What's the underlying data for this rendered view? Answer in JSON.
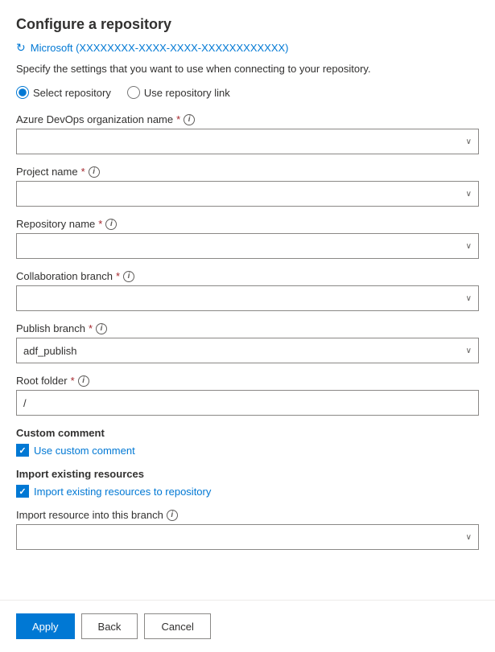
{
  "page": {
    "title": "Configure a repository",
    "org_icon": "↻",
    "org_name": "Microsoft (XXXXXXXX-XXXX-XXXX-XXXXXXXXXXXX)",
    "description": "Specify the settings that you want to use when connecting to your repository.",
    "radio_options": [
      {
        "id": "select-repo",
        "label": "Select repository",
        "checked": true
      },
      {
        "id": "use-link",
        "label": "Use repository link",
        "checked": false
      }
    ],
    "fields": [
      {
        "id": "azure-devops-org",
        "label": "Azure DevOps organization name",
        "required": true,
        "has_info": true,
        "type": "dropdown",
        "value": "",
        "placeholder": ""
      },
      {
        "id": "project-name",
        "label": "Project name",
        "required": true,
        "has_info": true,
        "type": "dropdown",
        "value": "",
        "placeholder": ""
      },
      {
        "id": "repository-name",
        "label": "Repository name",
        "required": true,
        "has_info": true,
        "type": "dropdown",
        "value": "",
        "placeholder": ""
      },
      {
        "id": "collaboration-branch",
        "label": "Collaboration branch",
        "required": true,
        "has_info": true,
        "type": "dropdown",
        "value": "",
        "placeholder": ""
      },
      {
        "id": "publish-branch",
        "label": "Publish branch",
        "required": true,
        "has_info": true,
        "type": "dropdown",
        "value": "adf_publish",
        "placeholder": ""
      },
      {
        "id": "root-folder",
        "label": "Root folder",
        "required": true,
        "has_info": true,
        "type": "text",
        "value": "/",
        "placeholder": ""
      }
    ],
    "checkboxes": [
      {
        "id": "custom-comment",
        "section_label": "Custom comment",
        "label": "Use custom comment",
        "checked": true
      },
      {
        "id": "import-resources",
        "section_label": "Import existing resources",
        "label": "Import existing resources to repository",
        "checked": true
      }
    ],
    "import_branch_field": {
      "id": "import-branch",
      "label": "Import resource into this branch",
      "has_info": true,
      "type": "dropdown",
      "value": "",
      "placeholder": ""
    },
    "buttons": {
      "apply": "Apply",
      "back": "Back",
      "cancel": "Cancel"
    },
    "info_icon_label": "i",
    "required_symbol": "*",
    "chevron": "∨"
  }
}
